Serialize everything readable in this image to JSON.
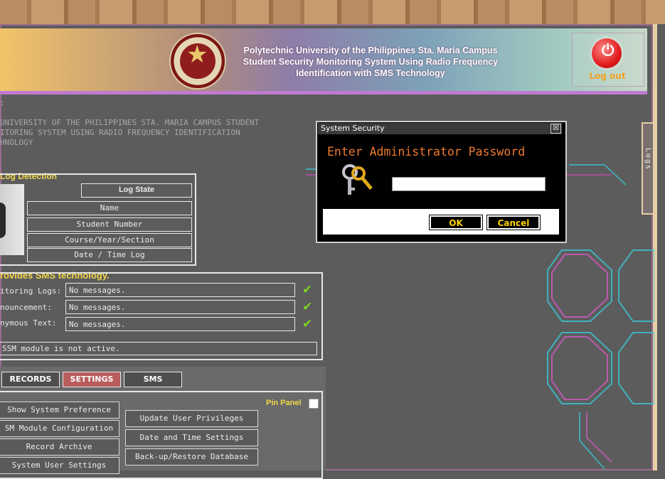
{
  "header": {
    "title_line1": "Polytechnic University of the Philippines Sta. Maria Campus",
    "title_line2": "Student Security Monitoring System Using Radio Frequency",
    "title_line3": "Identification with SMS Technology",
    "logout_label": "Log out"
  },
  "system": {
    "label_fragment": ":",
    "desc_line1": "UNIVERSITY OF THE PHILIPPINES STA. MARIA CAMPUS STUDENT",
    "desc_line2": "ITORING SYSTEM USING RADIO FREQUENCY IDENTIFICATION",
    "desc_line3": "HNOLOGY"
  },
  "side_tab_label": "Logs",
  "log_detection": {
    "title": "Log Detection",
    "log_state": "Log State",
    "fields": [
      "Name",
      "Student Number",
      "Course/Year/Section",
      "Date / Time Log"
    ]
  },
  "sms": {
    "title": "rovides SMS technology.",
    "rows": [
      {
        "label": "itoring Logs:",
        "value": "No messages."
      },
      {
        "label": "nouncement:",
        "value": "No messages."
      },
      {
        "label": "nymous Text:",
        "value": "No messages."
      }
    ],
    "gsm_status": "SSM module is not active."
  },
  "tabs": {
    "records": "RECORDS",
    "settings": "SETTINGS",
    "sms": "SMS"
  },
  "settings_panel": {
    "pin_label": "Pin Panel",
    "left_buttons": [
      "Show System Preference",
      "SM Module Configuration",
      "Record Archive",
      "System User Settings"
    ],
    "right_buttons": [
      "Update User Privileges",
      "Date and Time Settings",
      "Back-up/Restore Database"
    ]
  },
  "dialog": {
    "title": "System Security",
    "close_glyph": "☒",
    "prompt": "Enter Administrator Password",
    "password_value": "",
    "ok_label": "OK",
    "cancel_label": "Cancel"
  },
  "colors": {
    "accent_orange": "#f07a30",
    "settings_tab_active": "#b95c5c",
    "button_yellow": "#ffd200",
    "check_green": "#7ed321"
  }
}
